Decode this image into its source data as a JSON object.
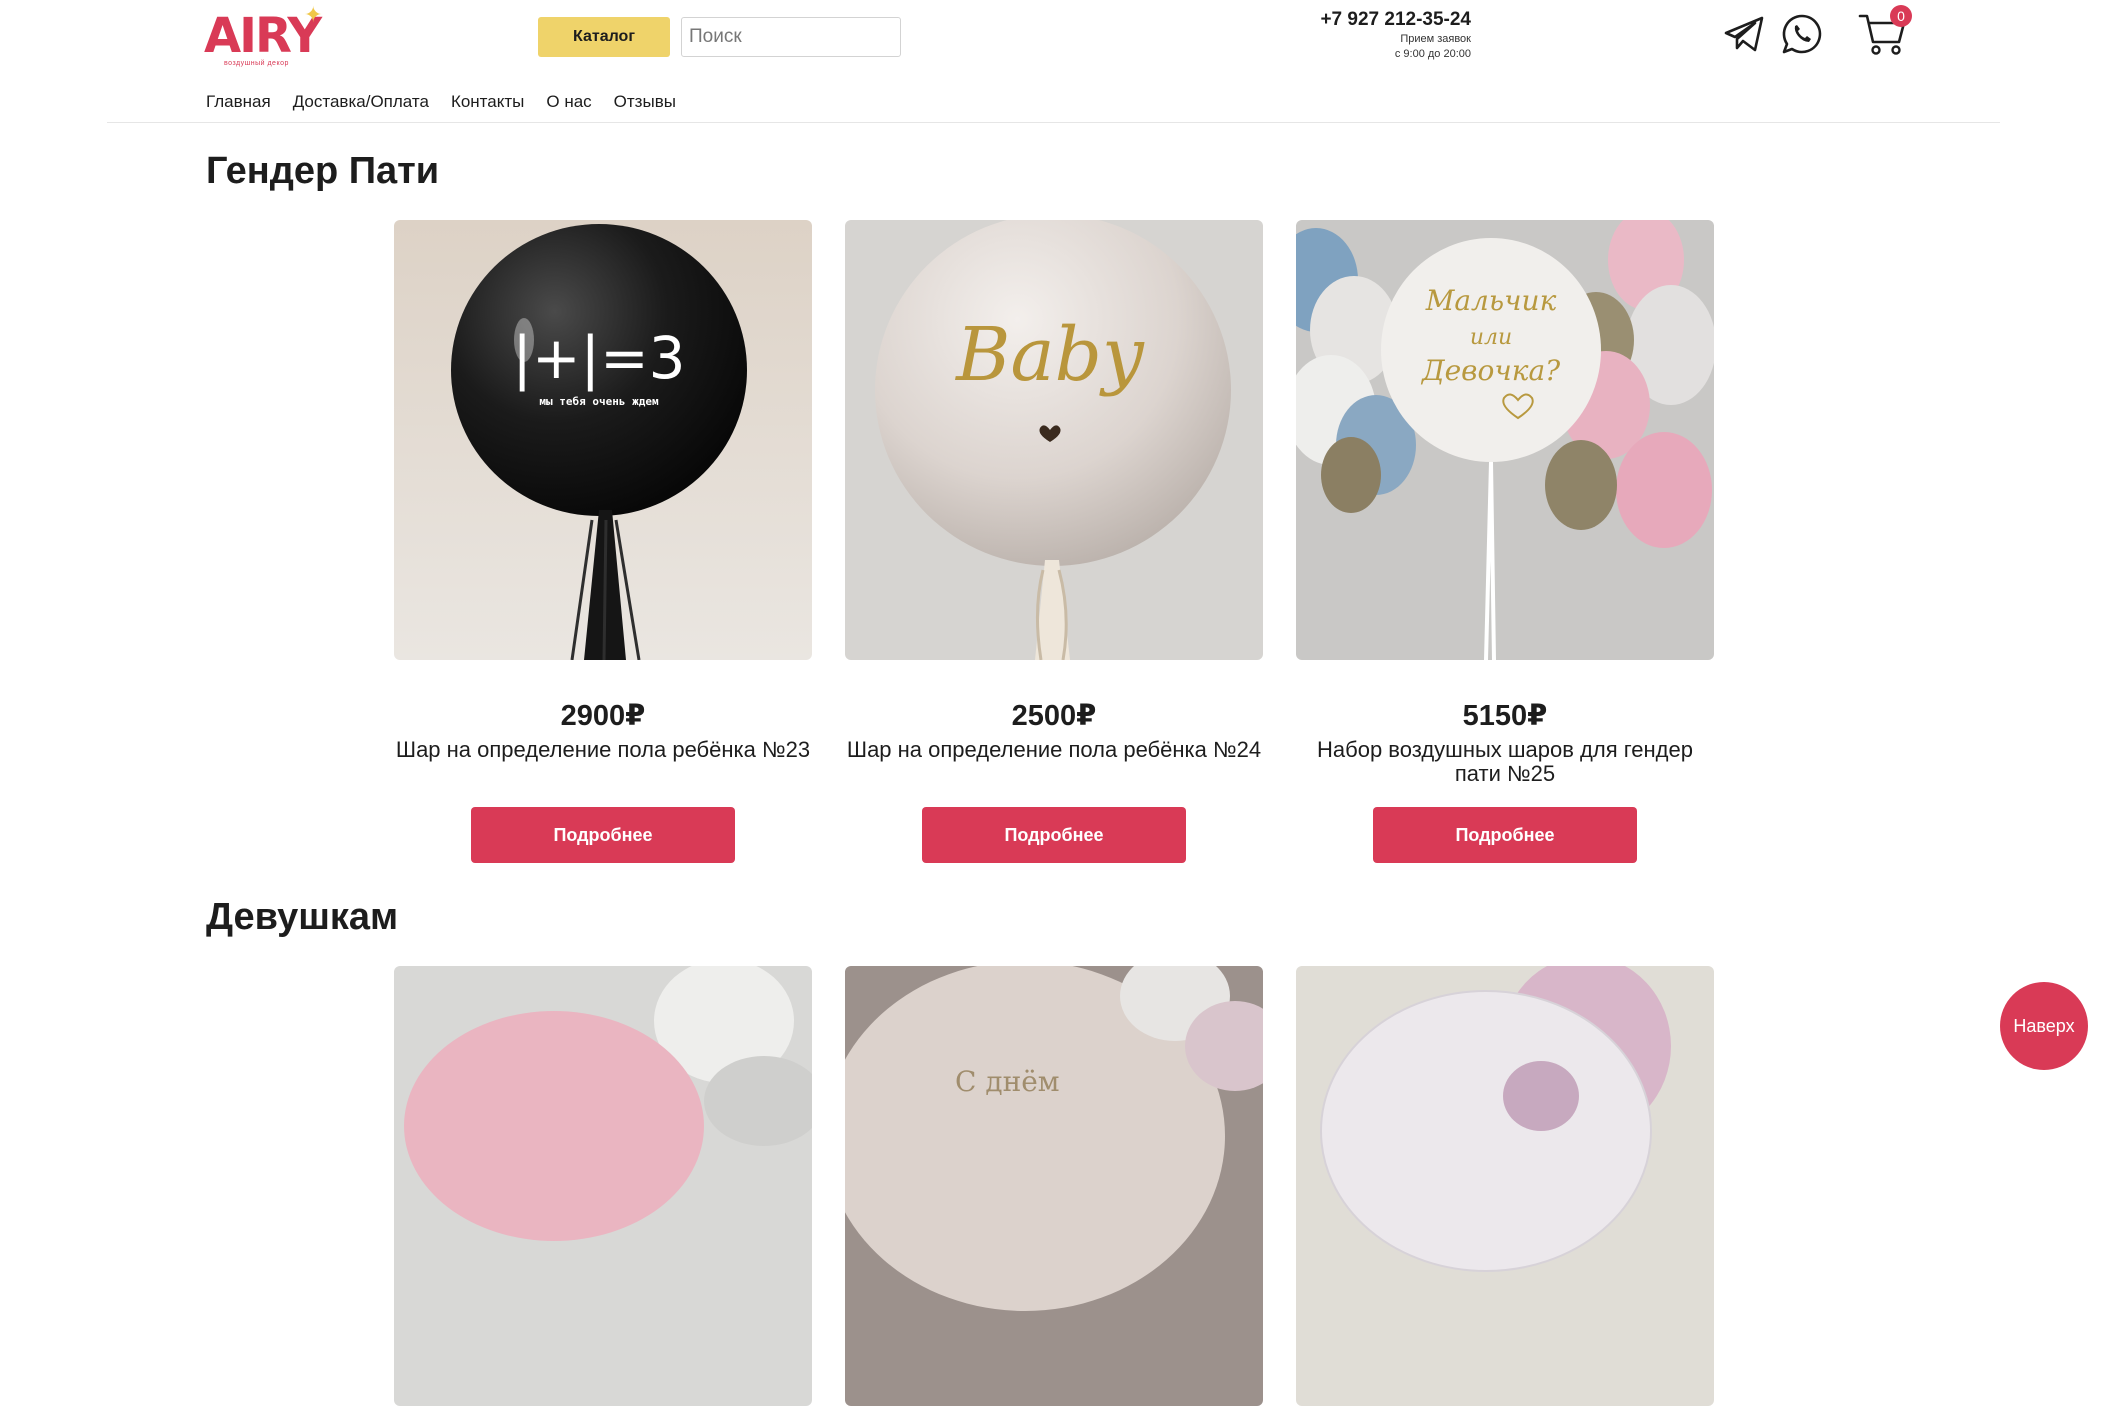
{
  "header": {
    "logo_text": "AIRY",
    "logo_subtitle": "воздушный декор",
    "catalog_label": "Каталог",
    "search_placeholder": "Поиск",
    "phone": "+7 927 212-35-24",
    "hours_line1": "Прием заявок",
    "hours_line2": "с 9:00 до 20:00",
    "cart_count": "0",
    "nav": [
      "Главная",
      "Доставка/Оплата",
      "Контакты",
      "О нас",
      "Отзывы"
    ]
  },
  "sections": [
    {
      "title": "Гендер Пати",
      "products": [
        {
          "price": "2900₽",
          "name": "Шар на определение пола ребёнка №23",
          "button": "Подробнее"
        },
        {
          "price": "2500₽",
          "name": "Шар на определение пола ребёнка №24",
          "button": "Подробнее"
        },
        {
          "price": "5150₽",
          "name": "Набор воздушных шаров для гендер пати №25",
          "button": "Подробнее"
        }
      ]
    },
    {
      "title": "Девушкам"
    }
  ],
  "photo_text": {
    "p1_main": "|+|=3",
    "p1_sub": "мы тебя очень ждем",
    "p2_main": "Baby",
    "p3_line1": "Мальчик",
    "p3_line2": "или",
    "p3_line3": "Девочка?",
    "p5_text": "С днём"
  },
  "scroll_top_label": "Наверх",
  "colors": {
    "accent": "#d93a56",
    "catalog": "#efd36a"
  }
}
